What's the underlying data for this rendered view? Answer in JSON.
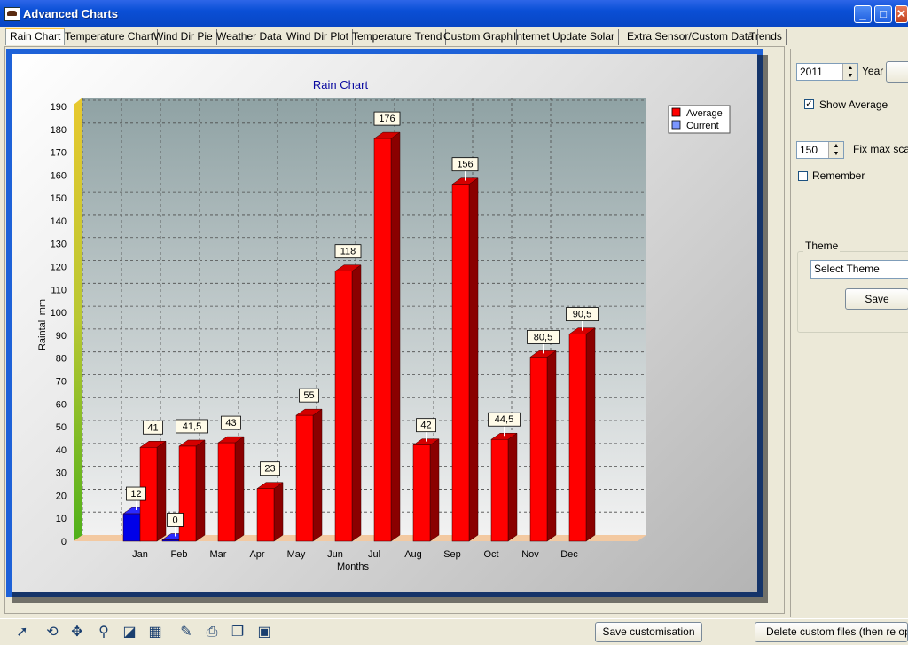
{
  "window": {
    "title": "Advanced Charts",
    "minimize": "_",
    "maximize": "□",
    "close": "✕"
  },
  "tabs": [
    "Rain Chart",
    "Temperature Chart",
    "Wind Dir Pie",
    "Weather Data",
    "Wind Dir Plot",
    "Temperature Trend",
    "Custom Graph",
    "Internet Update",
    "Solar",
    "Extra Sensor/Custom Data",
    "Trends"
  ],
  "active_tab": "Rain Chart",
  "chart_data": {
    "type": "bar",
    "title": "Rain Chart",
    "xlabel": "Months",
    "ylabel": "Raintall mm",
    "categories": [
      "Jan",
      "Feb",
      "Mar",
      "Apr",
      "May",
      "Jun",
      "Jul",
      "Aug",
      "Sep",
      "Oct",
      "Nov",
      "Dec"
    ],
    "series": [
      {
        "name": "Average",
        "color": "#ff0000",
        "values": [
          41,
          41.5,
          43,
          23,
          55,
          118,
          176,
          42,
          156,
          44.5,
          80.5,
          90.5
        ],
        "labels": [
          "41",
          "41,5",
          "43",
          "23",
          "55",
          "118",
          "176",
          "42",
          "156",
          "44,5",
          "80,5",
          "90,5"
        ]
      },
      {
        "name": "Current",
        "color": "#0000ff",
        "values": [
          12,
          0,
          null,
          null,
          null,
          null,
          null,
          null,
          null,
          null,
          null,
          null
        ],
        "labels": [
          "12",
          "0",
          "",
          "",
          "",
          "",
          "",
          "",
          "",
          "",
          "",
          ""
        ]
      }
    ],
    "ylim": [
      0,
      190
    ],
    "yticks": [
      0,
      10,
      20,
      30,
      40,
      50,
      60,
      70,
      80,
      90,
      100,
      110,
      120,
      130,
      140,
      150,
      160,
      170,
      180,
      190
    ],
    "grid": true,
    "legend": "top-right"
  },
  "controls": {
    "year_value": "2011",
    "year_label": "Year",
    "show_average_label": "Show Average",
    "show_average_checked": true,
    "max_scale_value": "150",
    "max_scale_label": "Fix max scale",
    "remember_label": "Remember",
    "remember_checked": false,
    "theme_group_label": "Theme",
    "theme_select_value": "Select Theme",
    "theme_save_label": "Save"
  },
  "toolbar": {
    "save_customisation_label": "Save customisation",
    "delete_custom_label": "Delete custom files (then re open)",
    "tools": [
      "pointer-icon",
      "rotate-icon",
      "move-icon",
      "zoom-icon",
      "depth-icon",
      "3d-icon",
      "edit-icon",
      "print-icon",
      "copy-icon",
      "save-icon"
    ]
  }
}
